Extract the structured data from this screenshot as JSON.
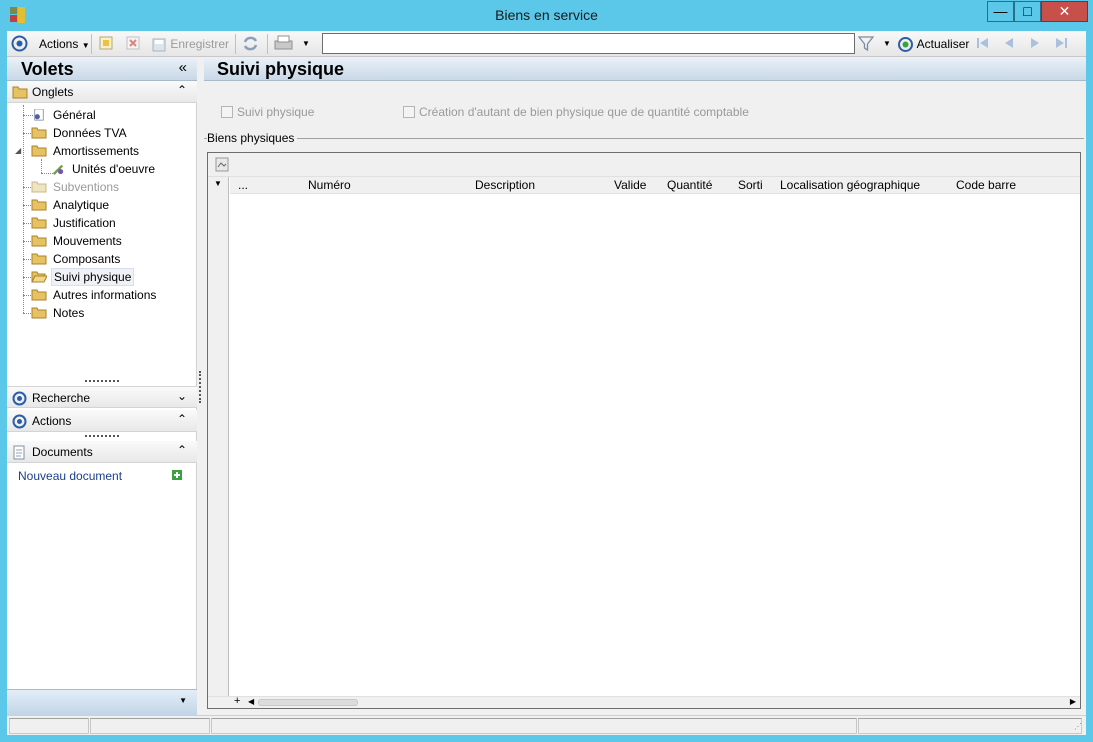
{
  "window": {
    "title": "Biens en service",
    "controls": {
      "minimize": "—",
      "maximize": "□",
      "close": "✕"
    }
  },
  "toolbar": {
    "actions_label": "Actions",
    "save_label": "Enregistrer",
    "search_value": "",
    "refresh_label": "Actualiser"
  },
  "left_panel": {
    "title": "Volets",
    "collapse_glyph": "«",
    "onglets": {
      "title": "Onglets",
      "items": [
        {
          "label": "Général",
          "level": 1,
          "icon": "settings-document-icon",
          "disabled": false
        },
        {
          "label": "Données TVA",
          "level": 1,
          "icon": "folder-icon",
          "disabled": false
        },
        {
          "label": "Amortissements",
          "level": 1,
          "icon": "folder-icon",
          "disabled": false,
          "expanded": true
        },
        {
          "label": "Unités d'oeuvre",
          "level": 2,
          "icon": "units-icon",
          "disabled": false
        },
        {
          "label": "Subventions",
          "level": 1,
          "icon": "folder-icon",
          "disabled": true
        },
        {
          "label": "Analytique",
          "level": 1,
          "icon": "folder-icon",
          "disabled": false
        },
        {
          "label": "Justification",
          "level": 1,
          "icon": "folder-icon",
          "disabled": false
        },
        {
          "label": "Mouvements",
          "level": 1,
          "icon": "folder-icon",
          "disabled": false
        },
        {
          "label": "Composants",
          "level": 1,
          "icon": "folder-icon",
          "disabled": false
        },
        {
          "label": "Suivi physique",
          "level": 1,
          "icon": "open-folder-icon",
          "disabled": false,
          "selected": true
        },
        {
          "label": "Autres informations",
          "level": 1,
          "icon": "folder-icon",
          "disabled": false
        },
        {
          "label": "Notes",
          "level": 1,
          "icon": "folder-icon",
          "disabled": false
        }
      ]
    },
    "recherche": {
      "title": "Recherche"
    },
    "actions": {
      "title": "Actions"
    },
    "documents": {
      "title": "Documents",
      "new_document": "Nouveau document"
    }
  },
  "main": {
    "title": "Suivi physique",
    "checkbox_suivi": {
      "label": "Suivi physique",
      "checked": false
    },
    "checkbox_creation": {
      "label": "Création d'autant de bien physique que de quantité comptable",
      "checked": false
    },
    "group_title": "Biens physiques",
    "grid": {
      "columns": [
        "...",
        "Numéro",
        "Description",
        "Valide",
        "Quantité",
        "Sorti",
        "Localisation géographique",
        "Code barre"
      ],
      "rows": []
    }
  },
  "colors": {
    "window_frame": "#5bc8ea",
    "close_button": "#c7504b",
    "panel_header": "#c9d8e7",
    "link": "#1a3e8c"
  }
}
